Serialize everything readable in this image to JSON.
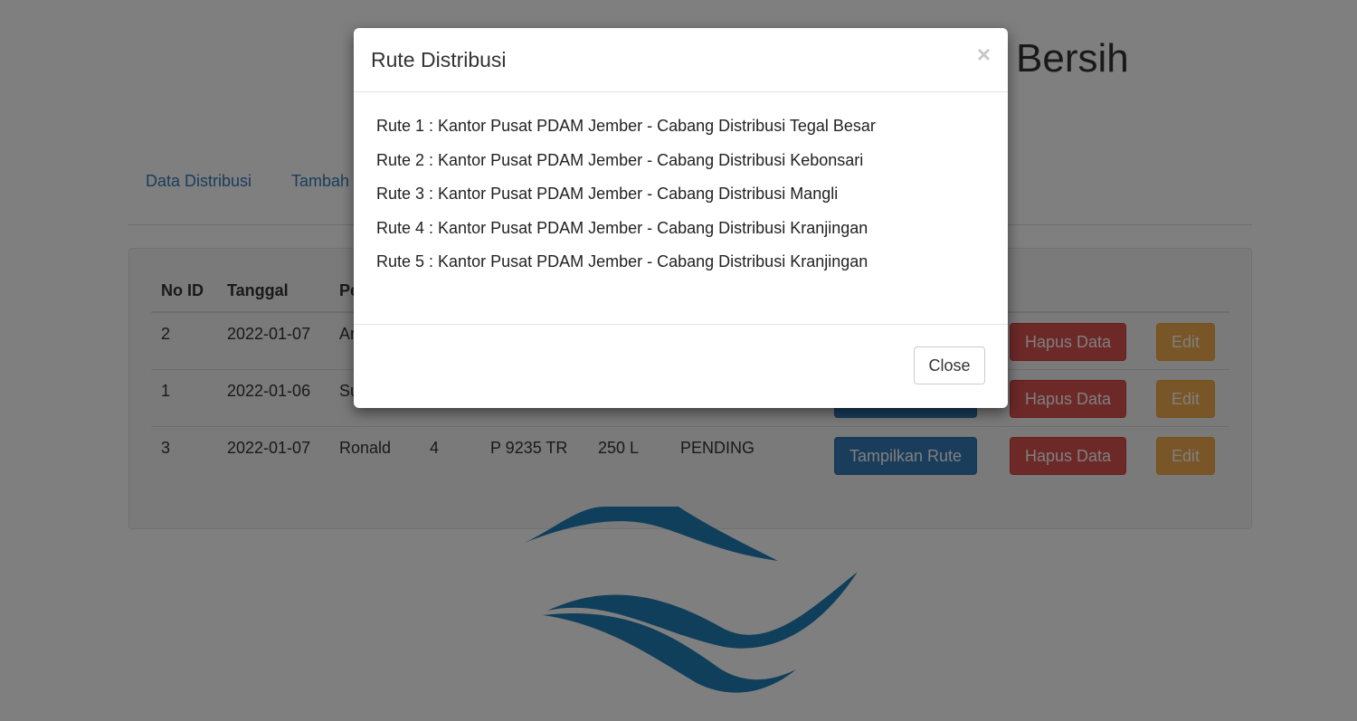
{
  "header": {
    "title_fragment": "Bersih"
  },
  "nav": {
    "items": [
      "Data Distribusi",
      "Tambah"
    ]
  },
  "table": {
    "headers": [
      "No ID",
      "Tanggal",
      "Pe"
    ],
    "rows": [
      {
        "id": "2",
        "tanggal": "2022-01-07",
        "col3": "An"
      },
      {
        "id": "1",
        "tanggal": "2022-01-06",
        "col3": "Su"
      },
      {
        "id": "3",
        "tanggal": "2022-01-07",
        "col3": "Ronald",
        "col4": "4",
        "plat": "P 9235 TR",
        "volume": "250 L",
        "status": "PENDING"
      }
    ],
    "show_route_label": "Tampilkan Rute",
    "delete_label": "Hapus Data",
    "edit_label": "Edit"
  },
  "modal": {
    "title": "Rute Distribusi",
    "close_symbol": "×",
    "routes": [
      "Rute 1 : Kantor Pusat PDAM Jember - Cabang Distribusi Tegal Besar",
      "Rute 2 : Kantor Pusat PDAM Jember - Cabang Distribusi Kebonsari",
      "Rute 3 : Kantor Pusat PDAM Jember - Cabang Distribusi Mangli",
      "Rute 4 : Kantor Pusat PDAM Jember - Cabang Distribusi Kranjingan",
      "Rute 5 : Kantor Pusat PDAM Jember - Cabang Distribusi Kranjingan"
    ],
    "close_label": "Close"
  },
  "colors": {
    "primary": "#337ab7",
    "danger": "#d9534f",
    "warning": "#f0ad4e",
    "logo": "#1f7fb7"
  }
}
